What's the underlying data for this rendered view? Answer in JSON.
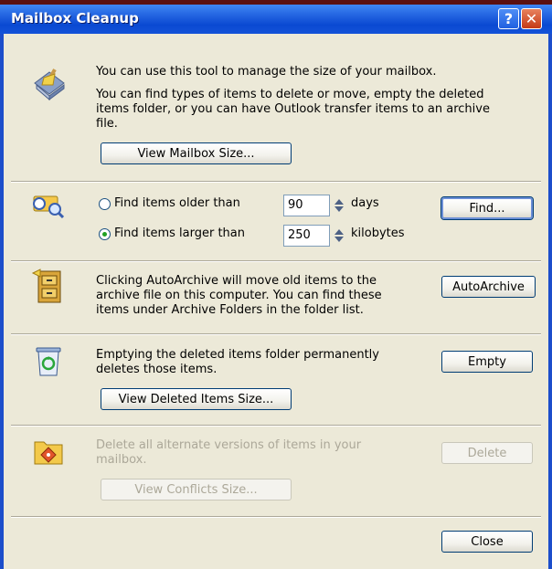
{
  "window": {
    "title": "Mailbox Cleanup",
    "help_glyph": "?",
    "close_glyph": "✕"
  },
  "intro": {
    "line1": "You can use this tool to manage the size of your mailbox.",
    "line2": "You can find types of items to delete or move, empty the deleted",
    "line3": "items folder, or you can have Outlook transfer items to an archive",
    "line4": "file.",
    "view_size_button": "View Mailbox Size..."
  },
  "find": {
    "older_label": "Find items older than",
    "older_value": "90",
    "older_unit": "days",
    "larger_label": "Find items larger than",
    "larger_value": "250",
    "larger_unit": "kilobytes",
    "selected_option": "larger",
    "find_button": "Find..."
  },
  "autoarchive": {
    "line1": "Clicking AutoArchive will move old items to the",
    "line2": "archive file on this computer. You can find these",
    "line3": "items under Archive Folders in the folder list.",
    "button": "AutoArchive"
  },
  "deleted": {
    "line1": "Emptying the deleted items folder permanently",
    "line2": "deletes those items.",
    "view_button": "View Deleted Items Size...",
    "empty_button": "Empty"
  },
  "conflicts": {
    "line1": "Delete all alternate versions of items in your",
    "line2": "mailbox.",
    "view_button": "View Conflicts Size...",
    "delete_button": "Delete"
  },
  "footer": {
    "close_button": "Close"
  },
  "colors": {
    "titlebar": "#0a49d2",
    "face": "#ece9d8",
    "disabled_text": "#aca899",
    "radio_dot": "#21a121"
  }
}
